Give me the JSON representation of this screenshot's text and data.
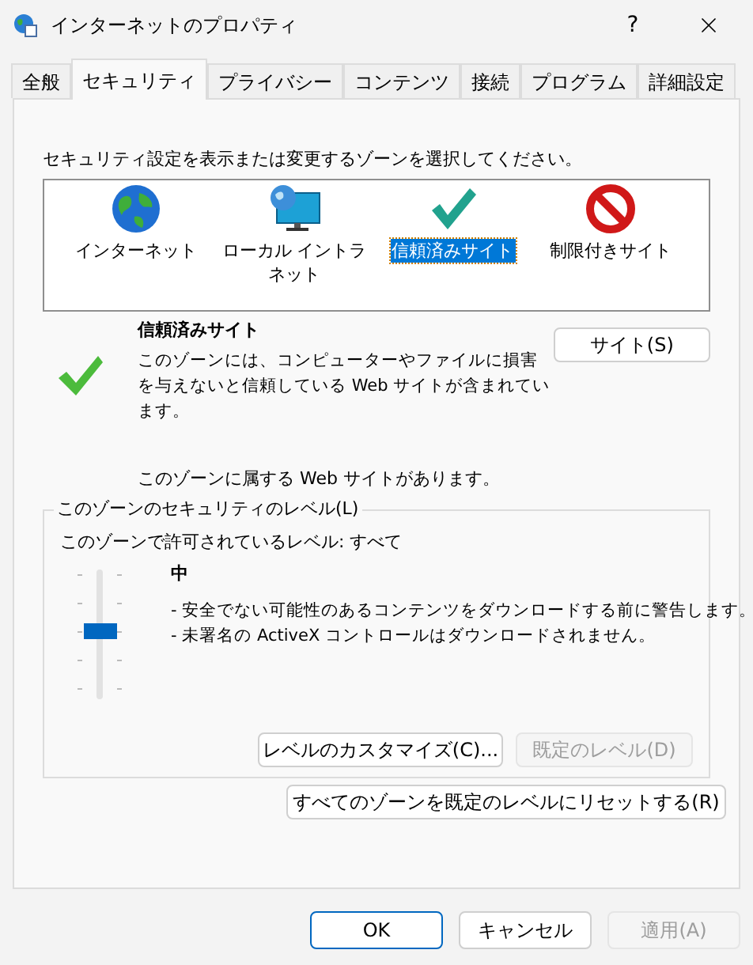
{
  "window": {
    "title": "インターネットのプロパティ",
    "help": "?"
  },
  "tabs": [
    {
      "label": "全般",
      "selected": false
    },
    {
      "label": "セキュリティ",
      "selected": true
    },
    {
      "label": "プライバシー",
      "selected": false
    },
    {
      "label": "コンテンツ",
      "selected": false
    },
    {
      "label": "接続",
      "selected": false
    },
    {
      "label": "プログラム",
      "selected": false
    },
    {
      "label": "詳細設定",
      "selected": false
    }
  ],
  "zone_prompt": "セキュリティ設定を表示または変更するゾーンを選択してください。",
  "zones": [
    {
      "label": "インターネット",
      "kind": "globe",
      "selected": false
    },
    {
      "label": "ローカル イントラネット",
      "kind": "intranet",
      "selected": false
    },
    {
      "label": "信頼済みサイト",
      "kind": "check",
      "selected": true
    },
    {
      "label": "制限付きサイト",
      "kind": "blocked",
      "selected": false
    }
  ],
  "zone_info": {
    "title": "信頼済みサイト",
    "description": "このゾーンには、コンピューターやファイルに損害を与えないと信頼している Web サイトが含まれています。",
    "sites_button": "サイト(S)",
    "note": "このゾーンに属する Web サイトがあります。"
  },
  "level_group": {
    "legend": "このゾーンのセキュリティのレベル(L)",
    "allowed": "このゾーンで許可されているレベル: すべて",
    "level_name": "中",
    "slider": {
      "level": 0.5
    },
    "bullets": [
      "- 安全でない可能性のあるコンテンツをダウンロードする前に警告します。",
      "- 未署名の ActiveX コントロールはダウンロードされません。"
    ],
    "buttons": [
      {
        "label": "レベルのカスタマイズ(C)...",
        "disabled": false
      },
      {
        "label": "既定のレベル(D)",
        "disabled": true
      }
    ]
  },
  "reset_button": "すべてのゾーンを既定のレベルにリセットする(R)",
  "footer_buttons": [
    {
      "label": "OK",
      "disabled": false,
      "default": true
    },
    {
      "label": "キャンセル",
      "disabled": false,
      "default": false
    },
    {
      "label": "適用(A)",
      "disabled": true,
      "default": false
    }
  ]
}
